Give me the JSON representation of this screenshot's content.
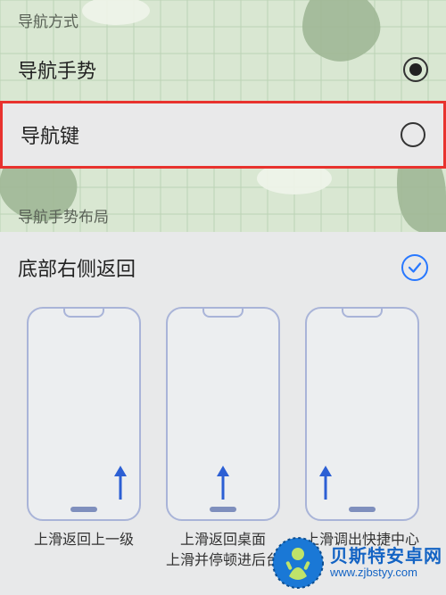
{
  "nav_mode": {
    "header": "导航方式",
    "options": [
      {
        "label": "导航手势",
        "selected": true,
        "highlighted": false
      },
      {
        "label": "导航键",
        "selected": false,
        "highlighted": true
      }
    ]
  },
  "gesture_layout": {
    "header": "导航手势布局",
    "selected_label": "底部右侧返回",
    "tiles": [
      {
        "arrow": "right",
        "caption_lines": [
          "上滑返回上一级"
        ]
      },
      {
        "arrow": "center",
        "caption_lines": [
          "上滑返回桌面",
          "上滑并停顿进后台"
        ]
      },
      {
        "arrow": "left",
        "caption_lines": [
          "上滑调出快捷中心"
        ]
      }
    ]
  },
  "colors": {
    "highlight_border": "#e8322e",
    "accent_blue": "#2878ff",
    "phone_outline": "#a9b4d8"
  },
  "watermark": {
    "name": "贝斯特安卓网",
    "url": "www.zjbstyy.com"
  }
}
